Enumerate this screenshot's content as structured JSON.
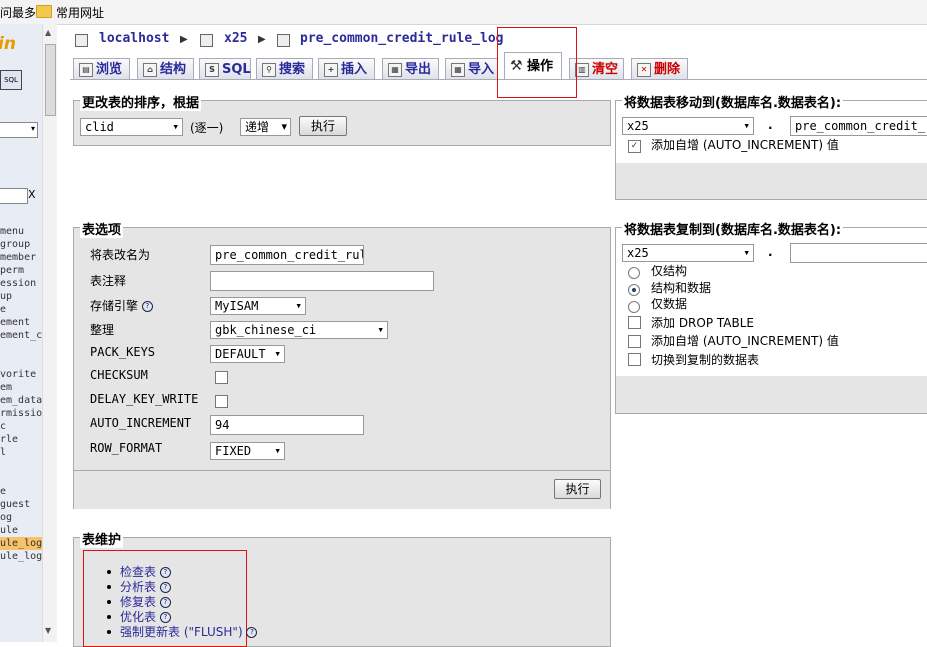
{
  "bookmarks": {
    "most_visited": "问最多",
    "common_sites": "常用网址"
  },
  "nav": {
    "logo": "in",
    "sql_icon": "SQL",
    "filter_clear": "X",
    "tables": [
      "menu",
      "group",
      "member",
      "perm",
      "ession",
      "up",
      "e",
      "ement",
      "ement_c",
      "",
      "",
      "vorite",
      "em",
      "em_data",
      "rmission",
      "c",
      "rle",
      "l",
      "",
      "",
      "e",
      "guest",
      "og",
      "ule",
      "ule_log",
      "ule_log"
    ]
  },
  "breadcrumb": {
    "server": "localhost",
    "database": "x25",
    "table": "pre_common_credit_rule_log"
  },
  "tabs": [
    {
      "label": "浏览",
      "icon": "browse-icon"
    },
    {
      "label": "结构",
      "icon": "structure-icon"
    },
    {
      "label": "SQL",
      "icon": "sql-icon"
    },
    {
      "label": "搜索",
      "icon": "search-icon"
    },
    {
      "label": "插入",
      "icon": "insert-icon"
    },
    {
      "label": "导出",
      "icon": "export-icon"
    },
    {
      "label": "导入",
      "icon": "import-icon"
    },
    {
      "label": "操作",
      "icon": "operations-icon"
    },
    {
      "label": "清空",
      "icon": "empty-icon"
    },
    {
      "label": "删除",
      "icon": "drop-icon"
    }
  ],
  "sort_panel": {
    "legend": "更改表的排序，根据",
    "column": "clid",
    "note": "(逐一)",
    "order": "递增",
    "go": "执行"
  },
  "options_panel": {
    "legend": "表选项",
    "rename_label": "将表改名为",
    "rename_value": "pre_common_credit_rul",
    "comment_label": "表注释",
    "comment_value": "",
    "engine_label": "存储引擎",
    "engine_value": "MyISAM",
    "collation_label": "整理",
    "collation_value": "gbk_chinese_ci",
    "pack_keys_label": "PACK_KEYS",
    "pack_keys_value": "DEFAULT",
    "checksum_label": "CHECKSUM",
    "delay_key_write_label": "DELAY_KEY_WRITE",
    "auto_increment_label": "AUTO_INCREMENT",
    "auto_increment_value": "94",
    "row_format_label": "ROW_FORMAT",
    "row_format_value": "FIXED",
    "go": "执行"
  },
  "maintenance_panel": {
    "legend": "表维护",
    "items": [
      "检查表",
      "分析表",
      "修复表",
      "优化表",
      "强制更新表 (\"FLUSH\")"
    ]
  },
  "move_panel": {
    "legend": "将数据表移动到(数据库名.数据表名):",
    "db": "x25",
    "dot": ".",
    "table": "pre_common_credit_r",
    "auto_inc_label": "添加自增 (AUTO_INCREMENT) 值"
  },
  "copy_panel": {
    "legend": "将数据表复制到(数据库名.数据表名):",
    "db": "x25",
    "dot": ".",
    "table": "",
    "structure_only": "仅结构",
    "structure_data": "结构和数据",
    "data_only": "仅数据",
    "add_drop": "添加 DROP TABLE",
    "auto_inc": "添加自增 (AUTO_INCREMENT) 值",
    "switch_to": "切换到复制的数据表"
  }
}
